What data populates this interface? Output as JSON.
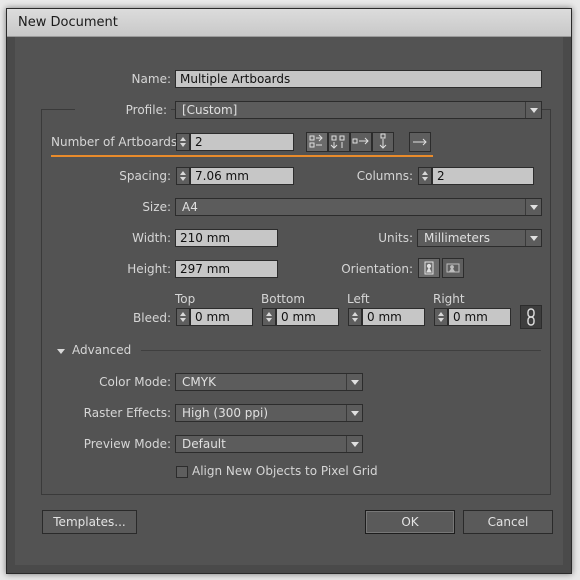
{
  "window": {
    "title": "New Document"
  },
  "name": {
    "label": "Name:",
    "value": "Multiple Artboards"
  },
  "profile": {
    "label": "Profile:",
    "value": "[Custom]"
  },
  "artboards": {
    "label": "Number of Artboards:",
    "value": "2",
    "arrange_icons": [
      "grid-by-row-icon",
      "grid-by-column-icon",
      "arrange-by-row-icon",
      "arrange-by-column-icon",
      "right-to-left-icon"
    ]
  },
  "spacing": {
    "label": "Spacing:",
    "value": "7.06 mm"
  },
  "columns": {
    "label": "Columns:",
    "value": "2"
  },
  "size": {
    "label": "Size:",
    "value": "A4"
  },
  "width": {
    "label": "Width:",
    "value": "210 mm"
  },
  "units": {
    "label": "Units:",
    "value": "Millimeters"
  },
  "height": {
    "label": "Height:",
    "value": "297 mm"
  },
  "orientation": {
    "label": "Orientation:",
    "icons": [
      "portrait-icon",
      "landscape-icon"
    ]
  },
  "bleed": {
    "label": "Bleed:",
    "top": {
      "label": "Top",
      "value": "0 mm"
    },
    "bottom": {
      "label": "Bottom",
      "value": "0 mm"
    },
    "left": {
      "label": "Left",
      "value": "0 mm"
    },
    "right": {
      "label": "Right",
      "value": "0 mm"
    }
  },
  "advanced": {
    "label": "Advanced"
  },
  "color_mode": {
    "label": "Color Mode:",
    "value": "CMYK"
  },
  "raster_effects": {
    "label": "Raster Effects:",
    "value": "High (300 ppi)"
  },
  "preview_mode": {
    "label": "Preview Mode:",
    "value": "Default"
  },
  "align_grid": {
    "label": "Align New Objects to Pixel Grid",
    "checked": false
  },
  "buttons": {
    "templates": "Templates...",
    "ok": "OK",
    "cancel": "Cancel"
  },
  "colors": {
    "accent": "#e98b2b",
    "dialog_bg": "#535353",
    "field_bg": "#c6c6c6"
  }
}
